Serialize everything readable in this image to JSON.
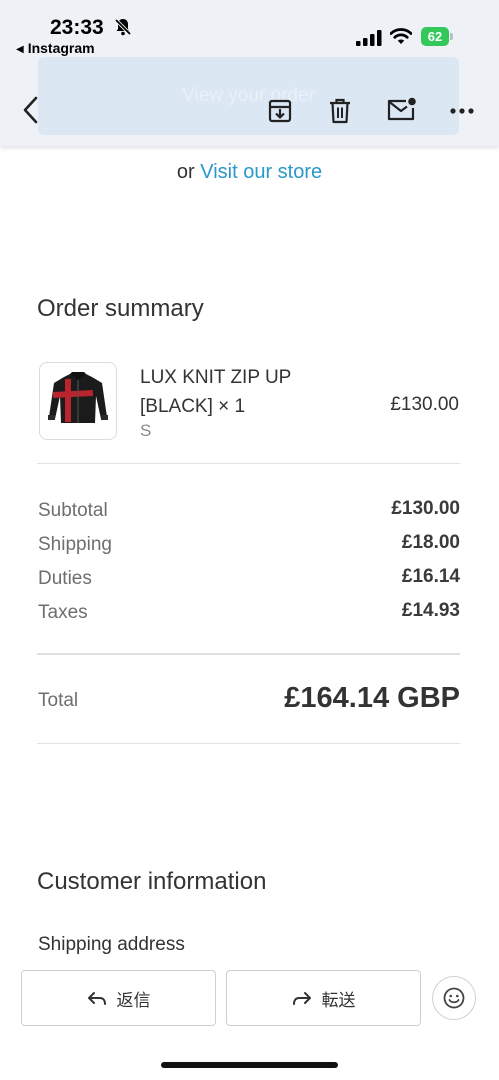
{
  "status_bar": {
    "time": "23:33",
    "back_app": "Instagram",
    "battery": "62"
  },
  "toolbar": {
    "ghost_banner": "View your order",
    "icons": [
      "back-chevron-icon",
      "archive-icon",
      "trash-icon",
      "mail-unread-icon",
      "more-icon"
    ]
  },
  "store": {
    "prefix": "or",
    "link_text": "Visit our store",
    "link_color": "#2a98c8"
  },
  "order_summary": {
    "title": "Order summary",
    "item": {
      "name": "LUX KNIT ZIP UP [BLACK] × 1",
      "variant": "S",
      "price": "£130.00"
    },
    "rows": [
      {
        "label": "Subtotal",
        "value": "£130.00"
      },
      {
        "label": "Shipping",
        "value": "£18.00"
      },
      {
        "label": "Duties",
        "value": "£16.14"
      },
      {
        "label": "Taxes",
        "value": "£14.93"
      }
    ],
    "total_label": "Total",
    "total_value": "£164.14 GBP"
  },
  "customer": {
    "title": "Customer information",
    "shipping_label": "Shipping address"
  },
  "bottom_bar": {
    "reply_label": "返信",
    "forward_label": "転送"
  },
  "colors": {
    "battery": "#34c759",
    "toolbar_bg": "#eef1f5",
    "accent_link": "#2a98c8"
  }
}
